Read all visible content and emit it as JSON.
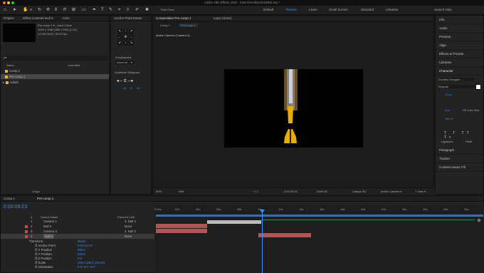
{
  "title": "Adobe After Effects 2022 - /Users/vernikam/Untitled.aep *",
  "workspaces": [
    "Default",
    "Review",
    "Learn",
    "Small Screen",
    "Standard",
    "Libraries"
  ],
  "search_help": "Search Help",
  "toolbar": {
    "snapping": "Snapping",
    "paint_label": "Free Form"
  },
  "project": {
    "tabs": [
      "Project",
      "Effect Controls Null 3",
      "Anim"
    ],
    "selected_name": "Pre-comp 1 ▾ , used 1 time",
    "selected_info": "1920 x 1080 (960 x 540) (1.00)",
    "selected_duration": "Δ 0:00:20:00, 25.00 fps",
    "search_placeholder": "ρ▾",
    "columns": [
      "Name",
      "Comment"
    ],
    "items": [
      {
        "name": "Comp 1",
        "color": "#e6b43d"
      },
      {
        "name": "Pre-comp 1",
        "color": "#e6b43d"
      },
      {
        "name": "Solids",
        "color": "#d9b33d"
      }
    ],
    "footer": "8 bpc"
  },
  "anchor_panel": {
    "title": "Anchor Point Mover",
    "keyframe_label": "If keyframed:",
    "keyframe_value": "Insert ke... ▾"
  },
  "wingman": {
    "title": "Keyframe Wingman",
    "values": [
      "40",
      "0",
      "40"
    ]
  },
  "composition": {
    "tabs": [
      "Composition Pre-comp 1",
      "Layer (none)"
    ],
    "breadcrumb": [
      "Comp 1",
      "Pre-comp 1"
    ],
    "active_camera": "Active Camera (Camera 3)",
    "footer": [
      "50%",
      "Half",
      "+0.0",
      "0:00:09:23",
      "Draft 3D",
      "Classic 3D",
      "Active Camera ▾",
      "1 View ▾"
    ]
  },
  "right_panel": {
    "items": [
      "Info",
      "Audio",
      "Preview",
      "Align",
      "Effects & Presets",
      "Libraries",
      "Character",
      "Paragraph",
      "Tracker",
      "Content-Aware Fill"
    ],
    "character": {
      "font": "Grantha Sangam ...",
      "style": "Regular",
      "size": "11 px",
      "tracking": "0 px",
      "fill": "Fill Over Stro",
      "scale": "100 %",
      "ligatures": "Ligatures",
      "hindi": "Hindi"
    }
  },
  "timeline": {
    "tabs": [
      "Comp 1",
      "Pre-comp 1"
    ],
    "time": "0:00:09:23",
    "ruler": [
      "0:00s",
      "02s",
      "04s",
      "06s",
      "08s",
      "10s",
      "12s",
      "14s",
      "16s",
      "18s",
      "20s",
      "22s",
      "24s",
      "26s",
      "28s",
      "30s"
    ],
    "layer_header": [
      "#",
      "Source Name",
      "Parent & Link"
    ],
    "layers": [
      {
        "num": "1",
        "name": "Camera 1",
        "parent": "4. Null 4"
      },
      {
        "num": "2",
        "name": "Null 3",
        "parent": "None"
      },
      {
        "num": "3",
        "name": "Camera 3",
        "parent": "4. Null 3"
      },
      {
        "num": "4",
        "name": "Null 3",
        "parent": "None"
      }
    ],
    "transform": {
      "label": "Transform",
      "reset": "Reset",
      "props": [
        {
          "name": "Anchor Point",
          "value": "0.0,0.0,0.0"
        },
        {
          "name": "X Position",
          "value": "960.0"
        },
        {
          "name": "Y Position",
          "value": "540.0"
        },
        {
          "name": "Z Position",
          "value": "0.0"
        },
        {
          "name": "Scale",
          "value": "100.0,100.0,100.0%"
        },
        {
          "name": "Orientation",
          "value": "0.0°,0.0°,0.0°"
        }
      ]
    }
  }
}
